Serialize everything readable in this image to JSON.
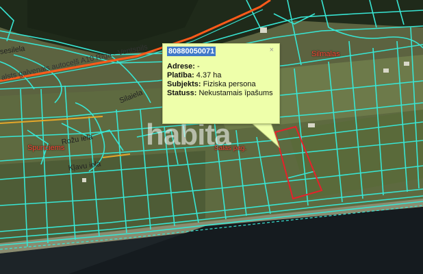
{
  "map": {
    "place_labels": {
      "silmalas": "Silmalas",
      "spunciems": "Spunciems",
      "salas_pag": "Salas pag."
    },
    "road_labels": {
      "sesilela": "sesilela",
      "highway": "alsts galvenais autoceļš A10 Rīga - Ventspils",
      "silaiela": "Silaiela",
      "rozuiela": "Rožu iela",
      "klavuiela": "Kļavu iela"
    },
    "colors": {
      "parcel_boundary": "#38e6d4",
      "selected_parcel": "#e8202a",
      "highway": "#ff5a1a",
      "place_label": "#ff4a3a",
      "popup_bg": "#eeffaa"
    }
  },
  "popup": {
    "parcel_id": "80880050071",
    "close_symbol": "×",
    "rows": [
      {
        "label": "Adrese:",
        "value": " -"
      },
      {
        "label": "Platība:",
        "value": " 4.37 ha"
      },
      {
        "label": "Subjekts:",
        "value": " Fiziska persona"
      },
      {
        "label": "Statuss:",
        "value": " Nekustamais īpašums"
      }
    ]
  },
  "watermark": "habita"
}
